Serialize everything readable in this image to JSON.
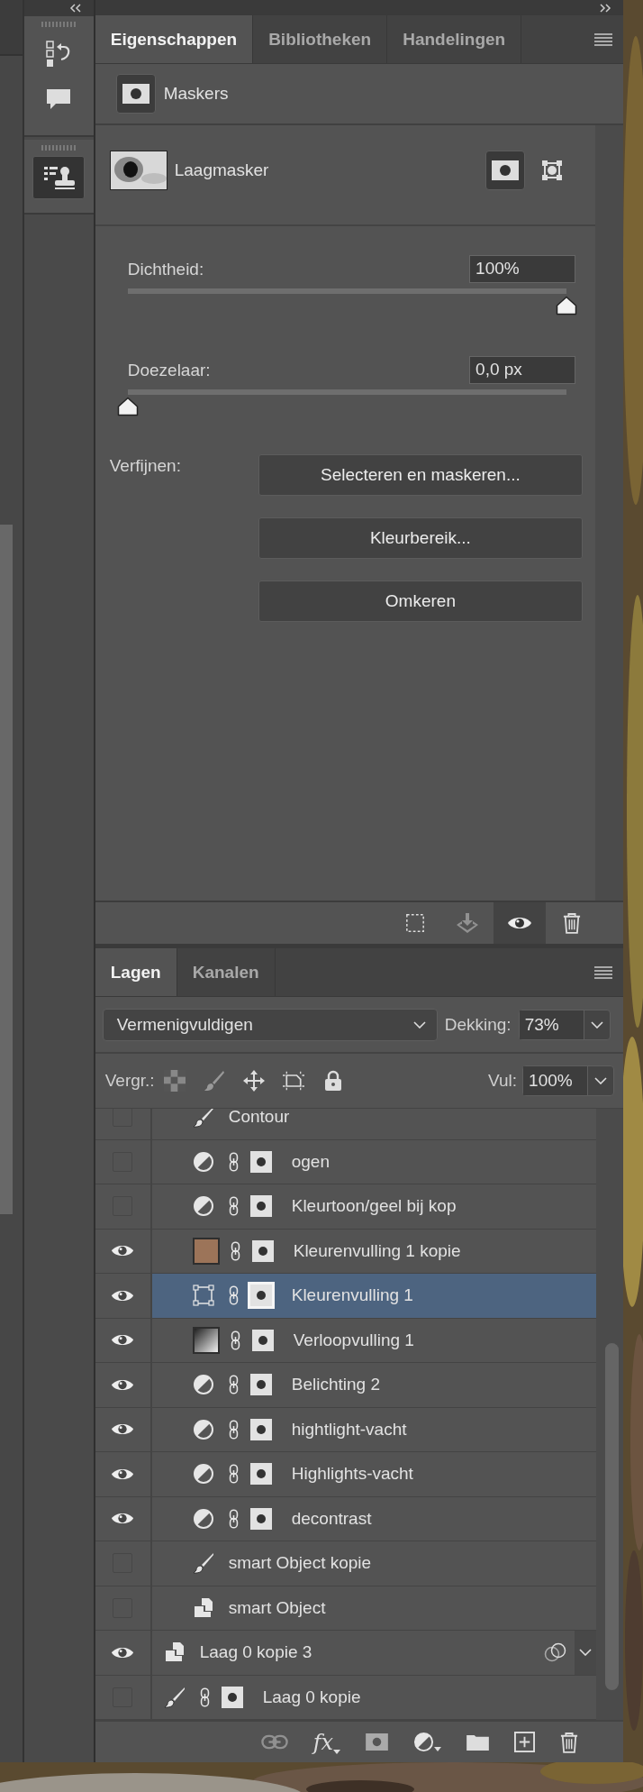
{
  "dock": [
    {
      "kind": "history",
      "selected": false
    },
    {
      "kind": "comments",
      "selected": false
    },
    {
      "kind": "properties",
      "selected": true
    }
  ],
  "properties_panel": {
    "tabs": [
      {
        "label": "Eigenschappen",
        "selected": true
      },
      {
        "label": "Bibliotheken",
        "selected": false
      },
      {
        "label": "Handelingen",
        "selected": false
      }
    ],
    "section_title": "Maskers",
    "mask_label": "Laagmasker",
    "mask_modes": [
      {
        "kind": "pixel",
        "selected": true
      },
      {
        "kind": "vector",
        "selected": false
      }
    ],
    "sliders": [
      {
        "label": "Dichtheid:",
        "value": "100%",
        "level": 1
      },
      {
        "label": "Doezelaar:",
        "value": "0,0 px",
        "level": 0
      }
    ],
    "refine_label": "Verfijnen:",
    "buttons": [
      "Selecteren en maskeren...",
      "Kleurbereik...",
      "Omkeren"
    ],
    "footer_tools": [
      {
        "kind": "load-selection",
        "selected": false,
        "disabled": false
      },
      {
        "kind": "apply-mask",
        "selected": false,
        "disabled": true
      },
      {
        "kind": "visibility",
        "selected": true,
        "disabled": false
      },
      {
        "kind": "delete",
        "selected": false,
        "disabled": false
      }
    ]
  },
  "layers_panel": {
    "tabs": [
      {
        "label": "Lagen",
        "selected": true
      },
      {
        "label": "Kanalen",
        "selected": false
      }
    ],
    "blend_mode": "Vermenigvuldigen",
    "opacity_label": "Dekking:",
    "opacity": "73%",
    "lock_label": "Vergr.:",
    "fill_label": "Vul:",
    "fill": "100%",
    "layers": [
      {
        "kind": "group",
        "children": [
          {
            "name": "Contour",
            "kind": "brush",
            "visible": false,
            "selected": false,
            "mask": false
          },
          {
            "name": "ogen",
            "kind": "adjustment",
            "visible": false,
            "selected": false,
            "mask": true
          },
          {
            "name": "Kleurtoon/geel bij kop",
            "kind": "adjustment",
            "visible": false,
            "selected": false,
            "mask": true
          },
          {
            "name": "Kleurenvulling 1 kopie",
            "kind": "fill-color",
            "color": "#9c7459",
            "visible": true,
            "selected": false,
            "mask": true
          },
          {
            "name": "Kleurenvulling 1",
            "kind": "shape",
            "visible": true,
            "selected": true,
            "mask": true
          },
          {
            "name": "Verloopvulling 1",
            "kind": "fill-gradient",
            "visible": true,
            "selected": false,
            "mask": true
          },
          {
            "name": "Belichting 2",
            "kind": "adjustment",
            "visible": true,
            "selected": false,
            "mask": true
          },
          {
            "name": "hightlight-vacht",
            "kind": "adjustment",
            "visible": true,
            "selected": false,
            "mask": true
          },
          {
            "name": "Highlights-vacht",
            "kind": "adjustment",
            "visible": true,
            "selected": false,
            "mask": true
          },
          {
            "name": "decontrast",
            "kind": "adjustment",
            "visible": true,
            "selected": false,
            "mask": true
          },
          {
            "name": "smart Object kopie",
            "kind": "brush",
            "visible": false,
            "selected": false,
            "mask": false
          },
          {
            "name": "smart Object",
            "kind": "smart-object",
            "visible": false,
            "selected": false,
            "mask": false
          }
        ]
      },
      {
        "name": "Laag 0 kopie 3",
        "kind": "smart-object",
        "visible": true,
        "selected": false,
        "mask": false,
        "expanded": false
      },
      {
        "name": "Laag 0 kopie",
        "kind": "brush",
        "visible": false,
        "selected": false,
        "mask": true
      }
    ],
    "tools": [
      {
        "kind": "link",
        "disabled": true
      },
      {
        "kind": "fx",
        "label": "fx",
        "disabled": false
      },
      {
        "kind": "mask",
        "disabled": false
      },
      {
        "kind": "adjustment",
        "disabled": false
      },
      {
        "kind": "folder",
        "disabled": false
      },
      {
        "kind": "new",
        "disabled": false
      },
      {
        "kind": "delete",
        "disabled": false
      }
    ]
  }
}
